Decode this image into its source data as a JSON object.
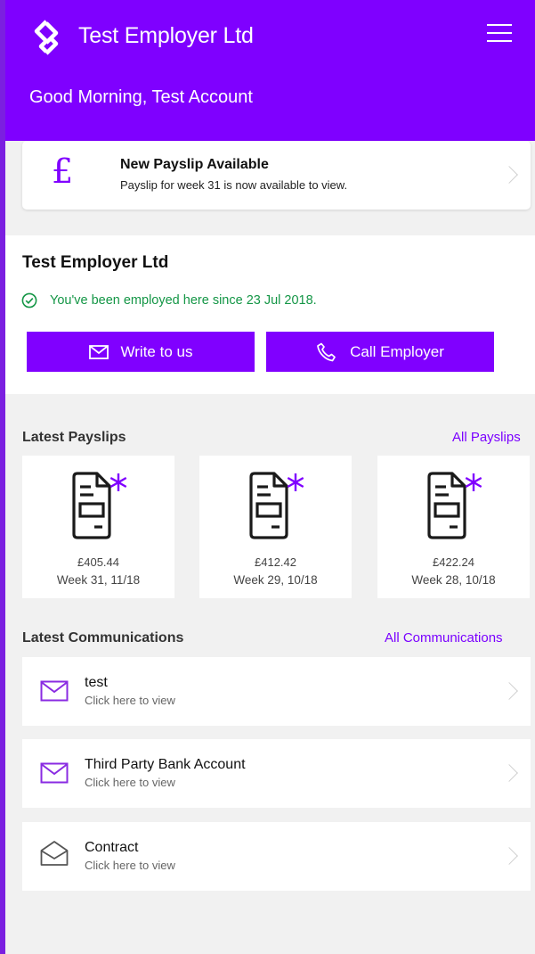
{
  "header": {
    "title": "Test Employer Ltd",
    "greeting": "Good Morning, Test Account"
  },
  "notice": {
    "symbol": "£",
    "title": "New Payslip Available",
    "subtitle": "Payslip for week 31 is now available to view."
  },
  "employer": {
    "name": "Test Employer Ltd",
    "since": "You've been employed here since 23 Jul 2018.",
    "write_label": "Write to us",
    "call_label": "Call Employer"
  },
  "payslips": {
    "title": "Latest Payslips",
    "link": "All Payslips",
    "items": [
      {
        "amount": "£405.44",
        "week": "Week 31, 11/18"
      },
      {
        "amount": "£412.42",
        "week": "Week 29, 10/18"
      },
      {
        "amount": "£422.24",
        "week": "Week 28, 10/18"
      }
    ]
  },
  "communications": {
    "title": "Latest Communications",
    "link": "All Communications",
    "items": [
      {
        "title": "test",
        "subtitle": "Click here to view",
        "icon": "envelope-closed-icon"
      },
      {
        "title": "Third Party Bank Account",
        "subtitle": "Click here to view",
        "icon": "envelope-closed-icon"
      },
      {
        "title": "Contract",
        "subtitle": "Click here to view",
        "icon": "envelope-open-icon"
      }
    ]
  },
  "colors": {
    "brand": "#7f00ff",
    "success": "#149646"
  }
}
